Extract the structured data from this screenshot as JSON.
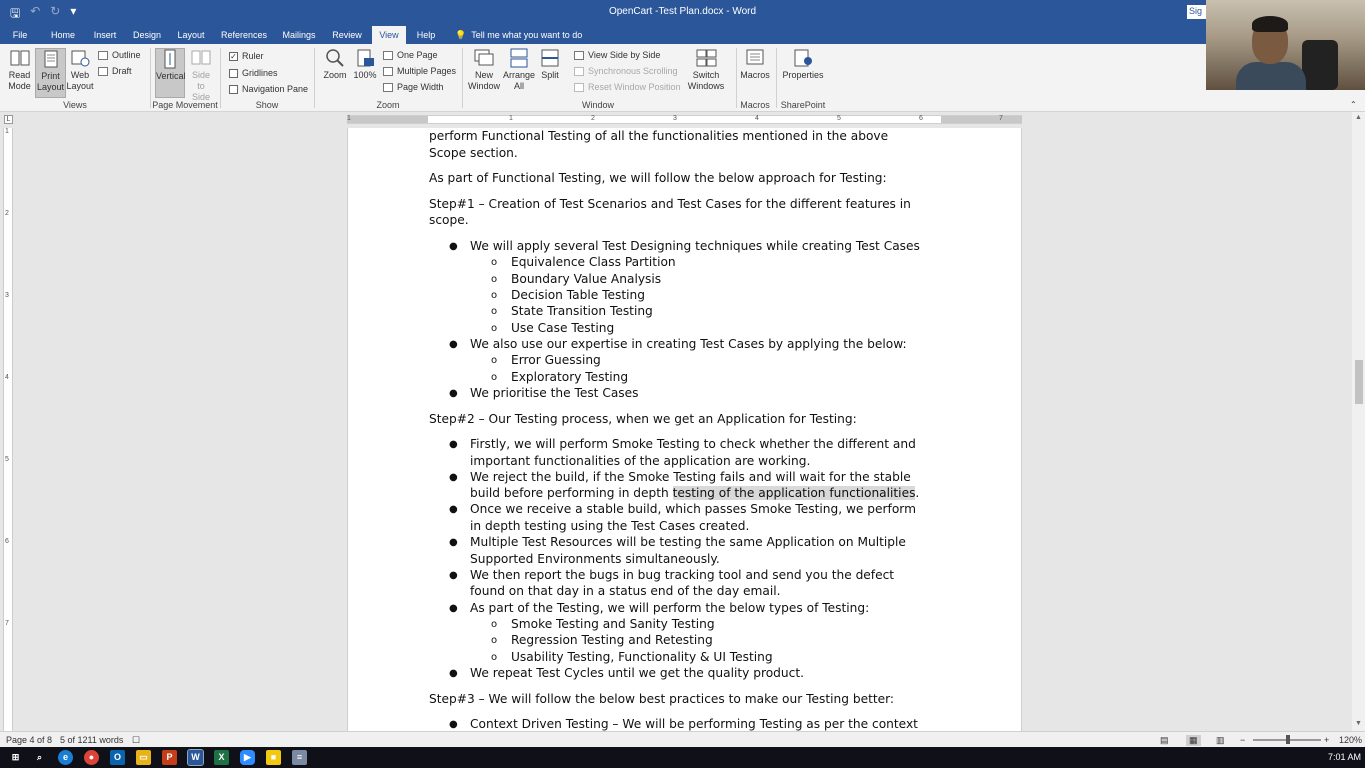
{
  "window": {
    "title": "OpenCart -Test Plan.docx  -  Word",
    "sign_in": "Sig"
  },
  "tabs": [
    "File",
    "Home",
    "Insert",
    "Design",
    "Layout",
    "References",
    "Mailings",
    "Review",
    "View",
    "Help"
  ],
  "active_tab": "View",
  "tell_me": "Tell me what you want to do",
  "ribbon": {
    "views": {
      "read_mode": "Read\nMode",
      "print_layout": "Print\nLayout",
      "web_layout": "Web\nLayout",
      "outline": "Outline",
      "draft": "Draft",
      "group": "Views"
    },
    "page_movement": {
      "vertical": "Vertical",
      "side_to_side": "Side\nto Side",
      "group": "Page Movement"
    },
    "show": {
      "ruler": "Ruler",
      "gridlines": "Gridlines",
      "navigation_pane": "Navigation Pane",
      "group": "Show",
      "ruler_checked": true,
      "gridlines_checked": false,
      "navigation_checked": false
    },
    "zoom": {
      "zoom": "Zoom",
      "hundred": "100%",
      "one_page": "One Page",
      "multiple_pages": "Multiple Pages",
      "page_width": "Page Width",
      "group": "Zoom"
    },
    "window": {
      "new_window": "New\nWindow",
      "arrange_all": "Arrange\nAll",
      "split": "Split",
      "view_side_by_side": "View Side by Side",
      "synchronous_scrolling": "Synchronous Scrolling",
      "reset_window_position": "Reset Window Position",
      "switch_windows": "Switch\nWindows",
      "group": "Window"
    },
    "macros": {
      "macros": "Macros",
      "group": "Macros"
    },
    "sharepoint": {
      "properties": "Properties",
      "group": "SharePoint"
    }
  },
  "ruler": {
    "h_numbers": [
      "1",
      "1",
      "2",
      "3",
      "4",
      "5",
      "6",
      "7"
    ],
    "v_numbers": [
      "1",
      "2",
      "3",
      "4",
      "5",
      "6",
      "7"
    ],
    "corner": "L"
  },
  "document": {
    "lines": [
      {
        "kind": "p",
        "text": "perform Functional Testing of all the functionalities mentioned in the above"
      },
      {
        "kind": "p",
        "text": "Scope section."
      },
      {
        "kind": "p",
        "text": "As part of Functional Testing, we will follow the below approach for Testing:"
      },
      {
        "kind": "p",
        "text": "Step#1 – Creation of Test Scenarios and Test Cases for the different features in"
      },
      {
        "kind": "p",
        "text": "scope."
      },
      {
        "kind": "b1",
        "text": "We will apply several Test Designing techniques while creating Test Cases"
      },
      {
        "kind": "b2",
        "text": "Equivalence Class Partition"
      },
      {
        "kind": "b2",
        "text": "Boundary Value Analysis"
      },
      {
        "kind": "b2",
        "text": "Decision Table Testing"
      },
      {
        "kind": "b2",
        "text": "State Transition Testing"
      },
      {
        "kind": "b2",
        "text": "Use Case Testing"
      },
      {
        "kind": "b1",
        "text": "We also use our expertise in creating Test Cases by applying the below:"
      },
      {
        "kind": "b2",
        "text": "Error Guessing"
      },
      {
        "kind": "b2",
        "text": "Exploratory Testing"
      },
      {
        "kind": "b1",
        "text": "We prioritise the Test Cases"
      },
      {
        "kind": "p",
        "text": "Step#2 – Our Testing process, when we get an Application for Testing:"
      },
      {
        "kind": "b1",
        "text": "Firstly, we will perform Smoke Testing to check whether the different and"
      },
      {
        "kind": "c1",
        "text": "important functionalities of the application are working."
      },
      {
        "kind": "b1",
        "text": "We reject the build, if the Smoke Testing fails and will wait for the stable"
      },
      {
        "kind": "c1h",
        "text": "build before performing in depth ",
        "hl": "testing of the application functionalities",
        "after": "."
      },
      {
        "kind": "b1",
        "text": "Once we receive a stable build, which passes Smoke Testing, we perform"
      },
      {
        "kind": "c1",
        "text": "in depth testing using the Test Cases created."
      },
      {
        "kind": "b1",
        "text": "Multiple Test Resources will be testing the same Application on Multiple"
      },
      {
        "kind": "c1",
        "text": "Supported Environments simultaneously."
      },
      {
        "kind": "b1",
        "text": "We then report the bugs in bug tracking tool and send you the defect"
      },
      {
        "kind": "c1",
        "text": "found on that day in a status end of the day email."
      },
      {
        "kind": "b1",
        "text": "As part of the Testing, we will perform the below types of Testing:"
      },
      {
        "kind": "b2",
        "text": "Smoke Testing and Sanity Testing"
      },
      {
        "kind": "b2",
        "text": "Regression Testing and Retesting"
      },
      {
        "kind": "b2",
        "text": "Usability Testing, Functionality & UI Testing"
      },
      {
        "kind": "b1",
        "text": "We repeat Test Cycles until we get the quality product."
      },
      {
        "kind": "p",
        "text": "Step#3 – We will follow the below best practices to make our Testing better:"
      },
      {
        "kind": "b1",
        "text": "Context Driven Testing – We will be performing Testing as per the context"
      }
    ]
  },
  "status": {
    "page": "Page 4 of 8",
    "words": "5 of 1211 words",
    "zoom": "120%"
  },
  "taskbar": {
    "time": "7:01 AM"
  }
}
